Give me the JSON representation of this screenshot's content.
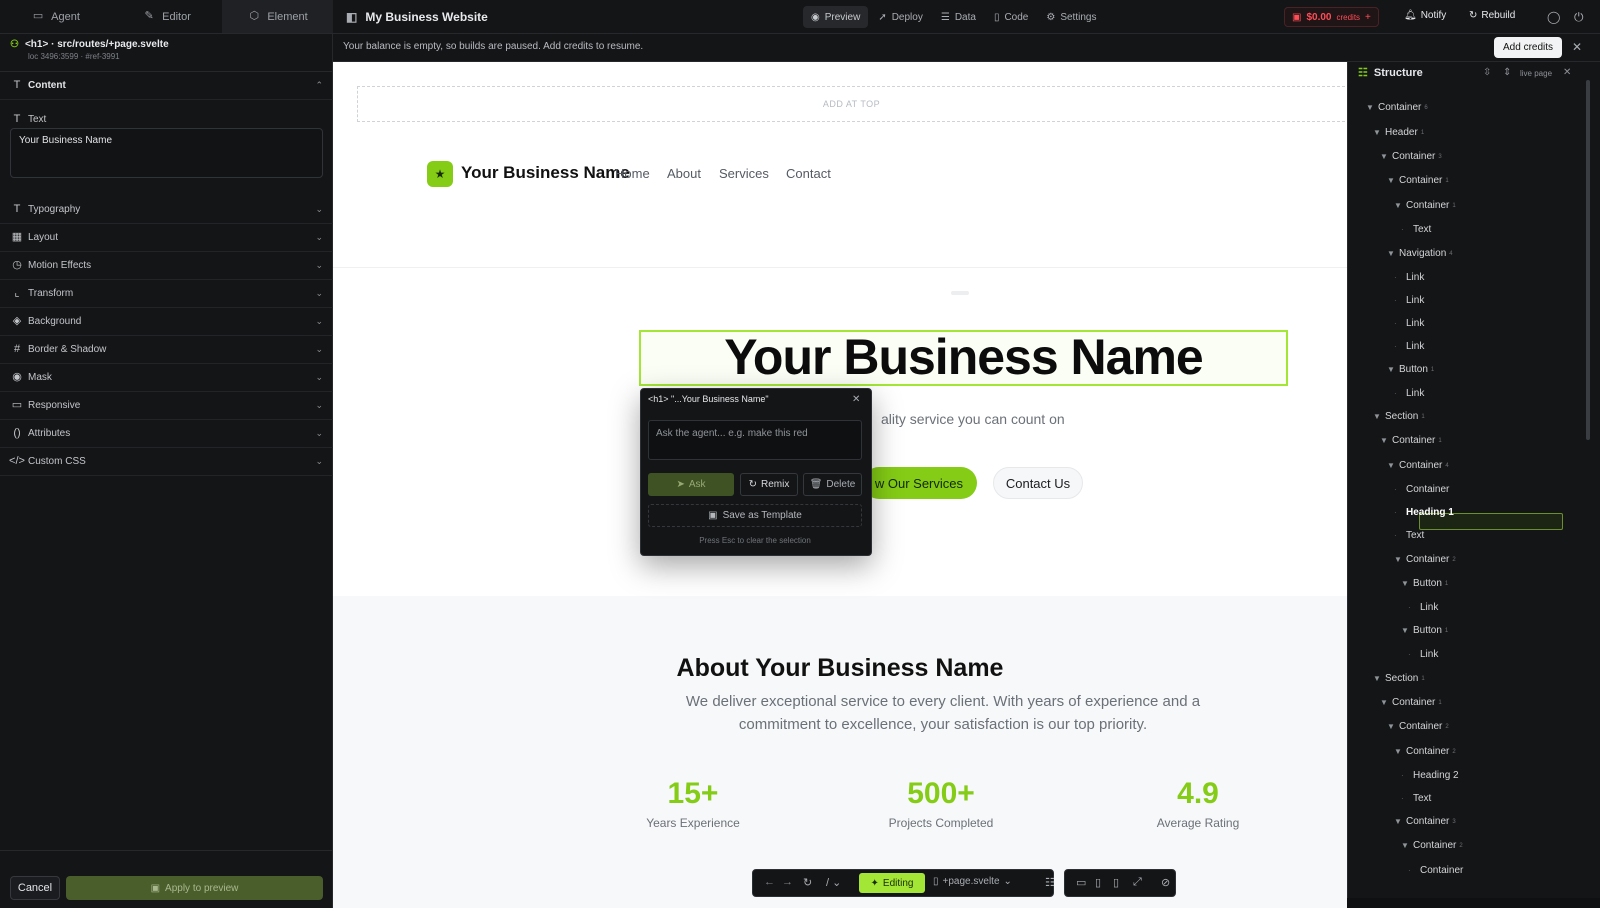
{
  "left_tabs": [
    {
      "label": "Agent",
      "icon": "chat-icon"
    },
    {
      "label": "Editor",
      "icon": "pencil-icon"
    },
    {
      "label": "Element",
      "icon": "cube-icon"
    }
  ],
  "element": {
    "tag": "<h1>",
    "path": "src/routes/+page.svelte",
    "loc": "loc 3496:3599 · #ref-3991"
  },
  "content_section": {
    "label": "Content"
  },
  "text_field": {
    "label": "Text",
    "value": "Your Business Name"
  },
  "sections": [
    "Typography",
    "Layout",
    "Motion Effects",
    "Transform",
    "Background",
    "Border & Shadow",
    "Mask",
    "Responsive",
    "Attributes",
    "Custom CSS"
  ],
  "footer": {
    "cancel": "Cancel",
    "apply": "Apply to preview"
  },
  "topbar": {
    "site_title": "My Business Website",
    "tabs": [
      "Preview",
      "Deploy",
      "Data",
      "Code",
      "Settings"
    ],
    "credits_amount": "$0.00",
    "credits_label": "credits",
    "credits_plus": "+",
    "notify": "Notify",
    "rebuild": "Rebuild"
  },
  "banner": {
    "text": "Your balance is empty, so builds are paused. Add credits to resume.",
    "button": "Add credits",
    "close": "✕"
  },
  "preview": {
    "add_at_top": "ADD AT TOP",
    "brand": "Your Business Name",
    "logo_glyph": "★",
    "nav": [
      "Home",
      "About",
      "Services",
      "Contact"
    ],
    "hero_title": "Your Business Name",
    "hero_sub": "ality service you can count on",
    "btn_services": "w Our Services",
    "btn_contact": "Contact Us",
    "about_title": "About Your Business Name",
    "about_text": "We deliver exceptional service to every client. With years of experience and a commitment to excellence, your satisfaction is our top priority.",
    "stats": [
      {
        "value": "15+",
        "label": "Years Experience"
      },
      {
        "value": "500+",
        "label": "Projects Completed"
      },
      {
        "value": "4.9",
        "label": "Average Rating"
      }
    ]
  },
  "popup": {
    "title": "<h1> \"...Your Business Name\"",
    "placeholder": "Ask the agent... e.g. make this red",
    "ask": "Ask",
    "remix": "Remix",
    "delete": "Delete",
    "save_template": "Save as Template",
    "hint": "Press Esc to clear the selection"
  },
  "toolbar": {
    "slash": "/",
    "editing": "Editing",
    "file": "+page.svelte"
  },
  "structure": {
    "title": "Structure",
    "live": "live page",
    "nodes": [
      {
        "label": "Container",
        "depth": 0,
        "branch": true,
        "count": "6"
      },
      {
        "label": "Header",
        "depth": 1,
        "branch": true,
        "count": "1"
      },
      {
        "label": "Container",
        "depth": 2,
        "branch": true,
        "count": "3"
      },
      {
        "label": "Container",
        "depth": 3,
        "branch": true,
        "count": "1"
      },
      {
        "label": "Container",
        "depth": 4,
        "branch": true,
        "count": "1"
      },
      {
        "label": "Text",
        "depth": 5,
        "branch": false,
        "count": ""
      },
      {
        "label": "Navigation",
        "depth": 3,
        "branch": true,
        "count": "4"
      },
      {
        "label": "Link",
        "depth": 4,
        "branch": false,
        "count": ""
      },
      {
        "label": "Link",
        "depth": 4,
        "branch": false,
        "count": ""
      },
      {
        "label": "Link",
        "depth": 4,
        "branch": false,
        "count": ""
      },
      {
        "label": "Link",
        "depth": 4,
        "branch": false,
        "count": ""
      },
      {
        "label": "Button",
        "depth": 3,
        "branch": true,
        "count": "1"
      },
      {
        "label": "Link",
        "depth": 4,
        "branch": false,
        "count": ""
      },
      {
        "label": "Section",
        "depth": 1,
        "branch": true,
        "count": "1"
      },
      {
        "label": "Container",
        "depth": 2,
        "branch": true,
        "count": "1"
      },
      {
        "label": "Container",
        "depth": 3,
        "branch": true,
        "count": "4"
      },
      {
        "label": "Container",
        "depth": 4,
        "branch": false,
        "count": ""
      },
      {
        "label": "Heading 1",
        "depth": 4,
        "branch": false,
        "count": "",
        "selected": true
      },
      {
        "label": "Text",
        "depth": 4,
        "branch": false,
        "count": ""
      },
      {
        "label": "Container",
        "depth": 4,
        "branch": true,
        "count": "2"
      },
      {
        "label": "Button",
        "depth": 5,
        "branch": true,
        "count": "1"
      },
      {
        "label": "Link",
        "depth": 6,
        "branch": false,
        "count": ""
      },
      {
        "label": "Button",
        "depth": 5,
        "branch": true,
        "count": "1"
      },
      {
        "label": "Link",
        "depth": 6,
        "branch": false,
        "count": ""
      },
      {
        "label": "Section",
        "depth": 1,
        "branch": true,
        "count": "1"
      },
      {
        "label": "Container",
        "depth": 2,
        "branch": true,
        "count": "1"
      },
      {
        "label": "Container",
        "depth": 3,
        "branch": true,
        "count": "2"
      },
      {
        "label": "Container",
        "depth": 4,
        "branch": true,
        "count": "2"
      },
      {
        "label": "Heading 2",
        "depth": 5,
        "branch": false,
        "count": ""
      },
      {
        "label": "Text",
        "depth": 5,
        "branch": false,
        "count": ""
      },
      {
        "label": "Container",
        "depth": 4,
        "branch": true,
        "count": "3"
      },
      {
        "label": "Container",
        "depth": 5,
        "branch": true,
        "count": "2"
      },
      {
        "label": "Container",
        "depth": 6,
        "branch": false,
        "count": ""
      }
    ]
  },
  "colors": {
    "accent": "#84cc16",
    "danger": "#ff4d57",
    "panel": "#141517"
  }
}
